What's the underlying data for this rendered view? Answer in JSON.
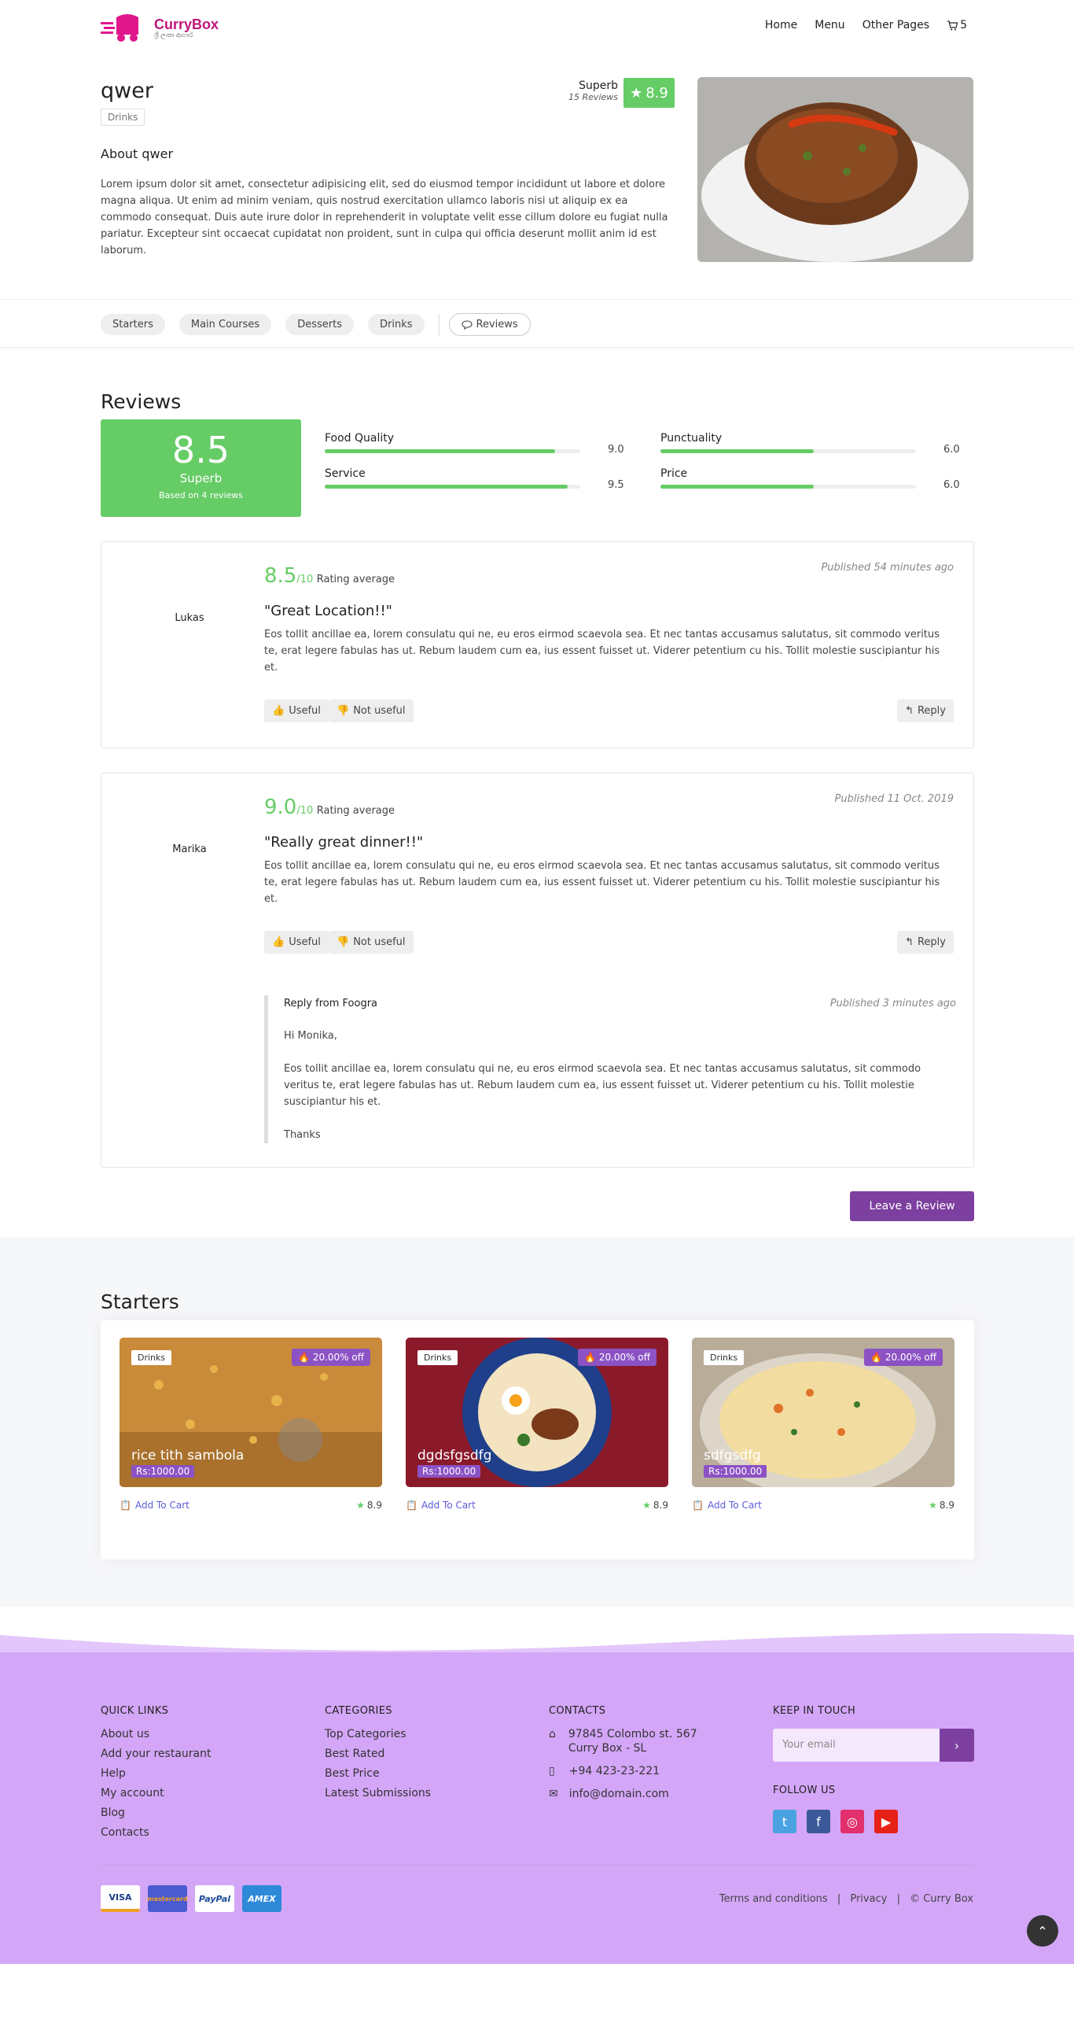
{
  "brand": {
    "name": "CurryBox",
    "tagline": "ශ්‍රී ලංකා ආහාර"
  },
  "nav": {
    "home": "Home",
    "menu": "Menu",
    "other": "Other Pages",
    "cart_count": "5"
  },
  "item": {
    "title": "qwer",
    "tag": "Drinks",
    "about_title": "About qwer",
    "about_text": "Lorem ipsum dolor sit amet, consectetur adipisicing elit, sed do eiusmod tempor incididunt ut labore et dolore magna aliqua. Ut enim ad minim veniam, quis nostrud exercitation ullamco laboris nisi ut aliquip ex ea commodo consequat. Duis aute irure dolor in reprehenderit in voluptate velit esse cillum dolore eu fugiat nulla pariatur. Excepteur sint occaecat cupidatat non proident, sunt in culpa qui officia deserunt mollit anim id est laborum.",
    "rating_label": "Superb",
    "reviews_count": "15 Reviews",
    "score": "8.9"
  },
  "tabs": [
    "Starters",
    "Main Courses",
    "Desserts",
    "Drinks"
  ],
  "reviews_tab": "Reviews",
  "reviews": {
    "title": "Reviews",
    "overall": "8.5",
    "overall_label": "Superb",
    "based_on": "Based on 4 reviews",
    "bars": [
      {
        "label": "Food Quality",
        "value": "9.0",
        "fraction": 0.9
      },
      {
        "label": "Punctuality",
        "value": "6.0",
        "fraction": 0.6
      },
      {
        "label": "Service",
        "value": "9.5",
        "fraction": 0.95
      },
      {
        "label": "Price",
        "value": "6.0",
        "fraction": 0.6
      }
    ],
    "items": [
      {
        "name": "Lukas",
        "score": "8.5",
        "out_of": "/10",
        "avg_label": "Rating average",
        "published": "Published 54 minutes ago",
        "title": "\"Great Location!!\"",
        "text": "Eos tollit ancillae ea, lorem consulatu qui ne, eu eros eirmod scaevola sea. Et nec tantas accusamus salutatus, sit commodo veritus te, erat legere fabulas has ut. Rebum laudem cum ea, ius essent fuisset ut. Viderer petentium cu his. Tollit molestie suscipiantur his et."
      },
      {
        "name": "Marika",
        "score": "9.0",
        "out_of": "/10",
        "avg_label": "Rating average",
        "published": "Published 11 Oct. 2019",
        "title": "\"Really great dinner!!\"",
        "text": "Eos tollit ancillae ea, lorem consulatu qui ne, eu eros eirmod scaevola sea. Et nec tantas accusamus salutatus, sit commodo veritus te, erat legere fabulas has ut. Rebum laudem cum ea, ius essent fuisset ut. Viderer petentium cu his. Tollit molestie suscipiantur his et."
      }
    ],
    "useful": "Useful",
    "not_useful": "Not useful",
    "reply": "Reply",
    "reply_from": "Reply from Foogra",
    "reply_published": "Published 3 minutes ago",
    "reply_greeting": "Hi Monika,",
    "reply_text": "Eos tollit ancillae ea, lorem consulatu qui ne, eu eros eirmod scaevola sea. Et nec tantas accusamus salutatus, sit commodo veritus te, erat legere fabulas has ut. Rebum laudem cum ea, ius essent fuisset ut. Viderer petentium cu his. Tollit molestie suscipiantur his et.",
    "reply_thanks": "Thanks",
    "leave": "Leave a Review"
  },
  "starters": {
    "title": "Starters",
    "cards": [
      {
        "tag": "Drinks",
        "discount": "20.00% off",
        "name": "rice tith sambola",
        "price": "Rs:1000.00",
        "add": "Add To Cart",
        "rating": "8.9"
      },
      {
        "tag": "Drinks",
        "discount": "20.00% off",
        "name": "dgdsfgsdfg",
        "price": "Rs:1000.00",
        "add": "Add To Cart",
        "rating": "8.9"
      },
      {
        "tag": "Drinks",
        "discount": "20.00% off",
        "name": "sdfgsdfg",
        "price": "Rs:1000.00",
        "add": "Add To Cart",
        "rating": "8.9"
      }
    ]
  },
  "footer": {
    "quick_title": "QUICK LINKS",
    "quick": [
      "About us",
      "Add your restaurant",
      "Help",
      "My account",
      "Blog",
      "Contacts"
    ],
    "cat_title": "CATEGORIES",
    "cats": [
      "Top Categories",
      "Best Rated",
      "Best Price",
      "Latest Submissions"
    ],
    "contact_title": "CONTACTS",
    "address1": "97845 Colombo st. 567",
    "address2": "Curry Box - SL",
    "phone": "+94 423-23-221",
    "email": "info@domain.com",
    "touch_title": "KEEP IN TOUCH",
    "email_placeholder": "Your email",
    "follow_title": "FOLLOW US",
    "payments": [
      "VISA",
      "mastercard",
      "PayPal",
      "AMEX"
    ],
    "terms": "Terms and conditions",
    "privacy": "Privacy",
    "copyright": "© Curry Box"
  },
  "colors": {
    "accent_green": "#66cc66",
    "purple": "#7d3fa0",
    "footer_bg": "#d4a6f8",
    "brand_pink": "#e0188c"
  }
}
